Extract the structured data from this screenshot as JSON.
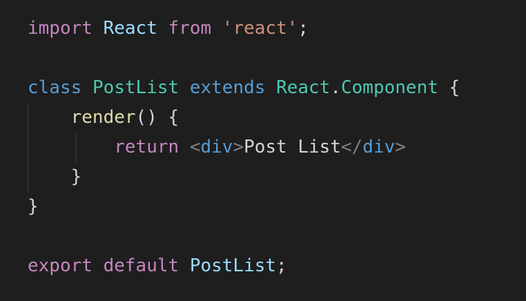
{
  "colors": {
    "background": "#1e1e1e",
    "keyword_control": "#c586c0",
    "keyword_storage": "#569cd6",
    "variable": "#9cdcfe",
    "type": "#4ec9b0",
    "string": "#ce9178",
    "function": "#dcdcaa",
    "punctuation": "#d4d4d4",
    "tag_bracket": "#808080",
    "tag": "#569cd6"
  },
  "code": {
    "line1": {
      "kw_import": "import",
      "sp1": " ",
      "name_react": "React",
      "sp2": " ",
      "kw_from": "from",
      "sp3": " ",
      "str_react": "'react'",
      "semi": ";"
    },
    "line3": {
      "kw_class": "class",
      "sp1": " ",
      "cls_postlist": "PostList",
      "sp2": " ",
      "kw_extends": "extends",
      "sp3": " ",
      "obj_react": "React",
      "dot": ".",
      "cls_component": "Component",
      "sp4": " ",
      "brace": "{"
    },
    "line4": {
      "indent": "    ",
      "fn_render": "render",
      "parens": "()",
      "sp1": " ",
      "brace": "{"
    },
    "line5": {
      "indent": "        ",
      "kw_return": "return",
      "sp1": " ",
      "lt1": "<",
      "tag_open": "div",
      "gt1": ">",
      "text": "Post List",
      "lt2": "</",
      "tag_close": "div",
      "gt2": ">"
    },
    "line6": {
      "indent": "    ",
      "brace": "}"
    },
    "line7": {
      "brace": "}"
    },
    "line9": {
      "kw_export": "export",
      "sp1": " ",
      "kw_default": "default",
      "sp2": " ",
      "name_postlist": "PostList",
      "semi": ";"
    }
  }
}
